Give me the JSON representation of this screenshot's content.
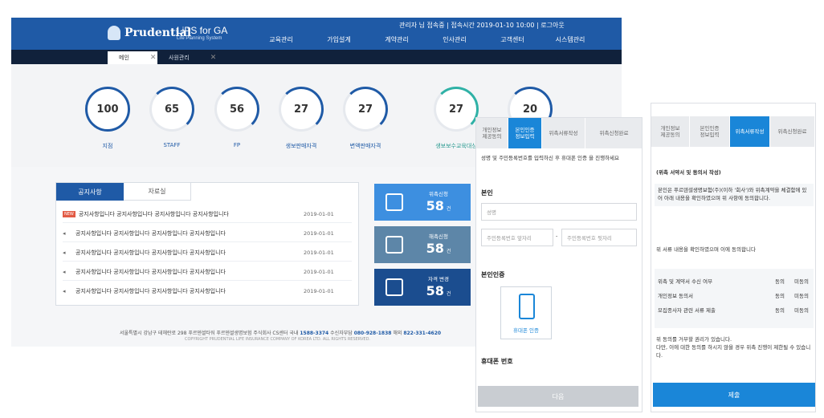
{
  "header": {
    "brand": "Prudential",
    "product": "LiPS for GA",
    "product_sub": "Life Planning System",
    "session_info": "관리자 님 접속중 | 접속시간 2019-01-10 10:00 | 로그아웃",
    "nav": [
      "교육관리",
      "가입설계",
      "계약관리",
      "인사관리",
      "고객센터",
      "시스템관리"
    ]
  },
  "tabs": [
    {
      "label": "메인",
      "close": "✕"
    },
    {
      "label": "사원관리",
      "close": "✕"
    }
  ],
  "stats": [
    {
      "value": "100",
      "label": "지점",
      "fill": 1.0
    },
    {
      "value": "65",
      "label": "STAFF",
      "fill": 0.65
    },
    {
      "value": "56",
      "label": "FP",
      "fill": 0.56
    },
    {
      "value": "27",
      "label": "생보판매자격",
      "fill": 0.27
    },
    {
      "value": "27",
      "label": "변액판매자격",
      "fill": 0.27
    },
    {
      "value": "27",
      "label": "생보보수교육대상",
      "fill": 0.27
    },
    {
      "value": "20",
      "label": "",
      "fill": 0.2
    }
  ],
  "board": {
    "tabs": [
      "공지사항",
      "자료실"
    ],
    "new_badge": "NEW",
    "rows": [
      {
        "title": "공지사항입니다 공지사항입니다 공지사항입니다 공지사항입니다",
        "date": "2019-01-01",
        "is_new": true
      },
      {
        "title": "공지사항입니다 공지사항입니다 공지사항입니다 공지사항입니다",
        "date": "2019-01-01",
        "is_new": false
      },
      {
        "title": "공지사항입니다 공지사항입니다 공지사항입니다 공지사항입니다",
        "date": "2019-01-01",
        "is_new": false
      },
      {
        "title": "공지사항입니다 공지사항입니다 공지사항입니다 공지사항입니다",
        "date": "2019-01-01",
        "is_new": false
      },
      {
        "title": "공지사항입니다 공지사항입니다 공지사항입니다 공지사항입니다",
        "date": "2019-01-01",
        "is_new": false
      }
    ]
  },
  "cards": [
    {
      "label": "위촉신청",
      "value": "58",
      "unit": "건",
      "color": "#3d8fe0"
    },
    {
      "label": "해촉신청",
      "value": "58",
      "unit": "건",
      "color": "#5d86a8"
    },
    {
      "label": "자격 변경",
      "value": "58",
      "unit": "건",
      "color": "#1b4d8f"
    }
  ],
  "footer": {
    "address": "서울특별시 강남구 테헤란로 298 푸르덴셜타워 푸르덴셜생명보험 주식회사",
    "cs_label": "CS센터 국내",
    "cs_phone": "1588-3374",
    "fax_label": "수신자부담",
    "fax_phone": "080-928-1838",
    "overseas_label": "해외",
    "overseas_phone": "822-331-4620",
    "copyright": "COPYRIGHT PRUDENTIAL LIFE INSURANCE COMPANY OF KOREA LTD. ALL RIGHTS RESERVED."
  },
  "mobile1": {
    "steps": [
      "개인정보\n제공동의",
      "본인인증\n정보입력",
      "위촉서류작성",
      "위촉신청완료"
    ],
    "intro": "성명 및 주민등록번호를 입력하신 후 휴대폰 인증 을 진행하세요",
    "section_title": "본인",
    "name_placeholder": "성명",
    "rrn_front_placeholder": "주민등록번호 앞자리",
    "rrn_dash": "-",
    "rrn_back_placeholder": "주민등록번호 뒷자리",
    "auth_title": "본인인증",
    "auth_button": "휴대폰 인증",
    "phone_title": "휴대폰 번호",
    "submit": "다음"
  },
  "mobile2": {
    "steps": [
      "개인정보\n제공동의",
      "본인인증\n정보입력",
      "위촉서류작성",
      "위촉신청완료"
    ],
    "section_title": "(위촉 서약서 및 동의서 작성)",
    "paragraph": "본인은 푸르덴셜생명보험(주)(이하 '회사')와 위촉계약을 체결함에 있어 아래 내용을 확인하였으며 위 사항에 동의합니다.",
    "subhead": "위 서류 내용을 확인하였으며 이에 동의합니다",
    "agreements": [
      {
        "label": "위촉 및 계약서 수신 여부",
        "agree": "동의",
        "disagree": "미동의"
      },
      {
        "label": "개인정보 동의서",
        "agree": "동의",
        "disagree": "미동의"
      },
      {
        "label": "모집종사자 관련 서류 제출",
        "agree": "동의",
        "disagree": "미동의"
      }
    ],
    "notice": "위 동의를 거부할 권리가 있습니다.\n다만, 이에 대한 동의를 하시지 않을 경우 위촉 진행이 제한될 수 있습니다.",
    "submit": "제출"
  }
}
